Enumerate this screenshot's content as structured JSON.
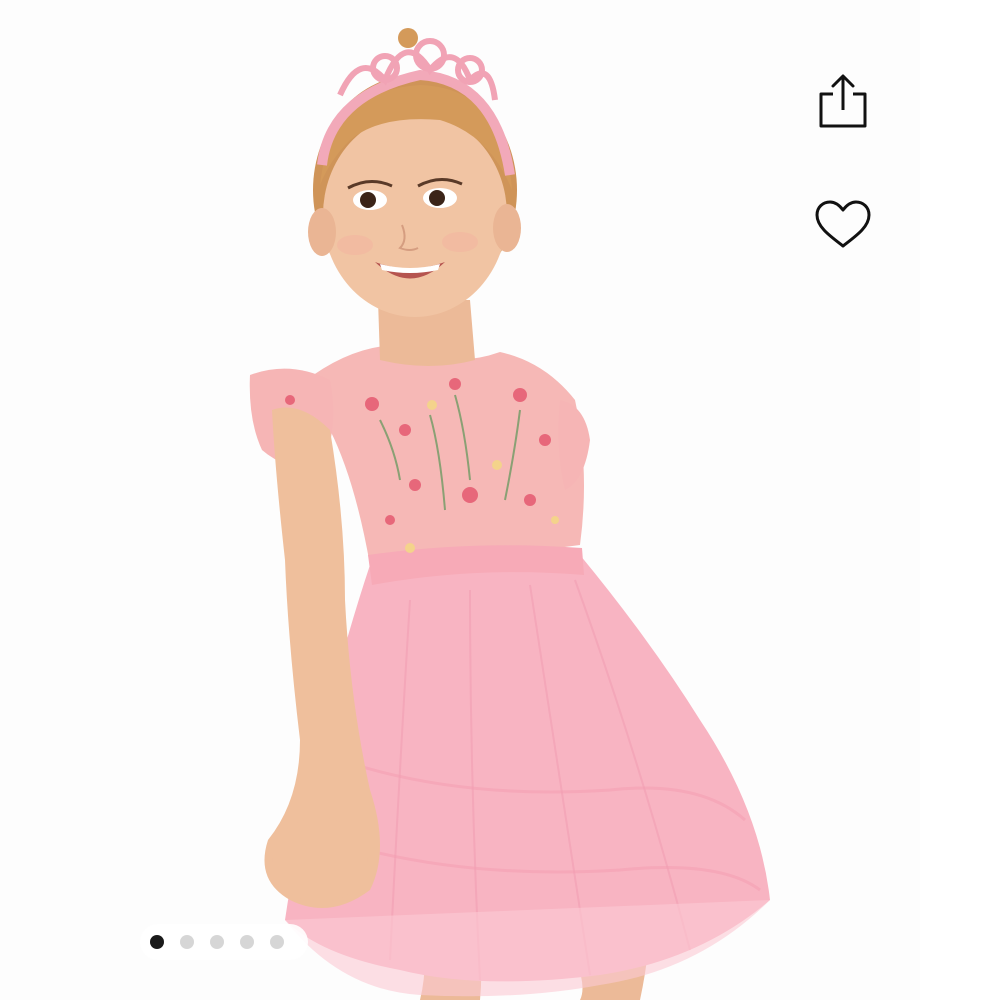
{
  "product": {
    "image_alt": "",
    "colors": {
      "skirt": "#f7b2c0",
      "bodice": "#f5b9b8",
      "skin": "#efc09e",
      "hair": "#d49a5a",
      "tiara": "#f1a8b8"
    }
  },
  "actions": {
    "share_icon": "share-icon",
    "favorite_icon": "heart-outline-icon"
  },
  "carousel": {
    "total_images": 5,
    "active_index": 0
  }
}
